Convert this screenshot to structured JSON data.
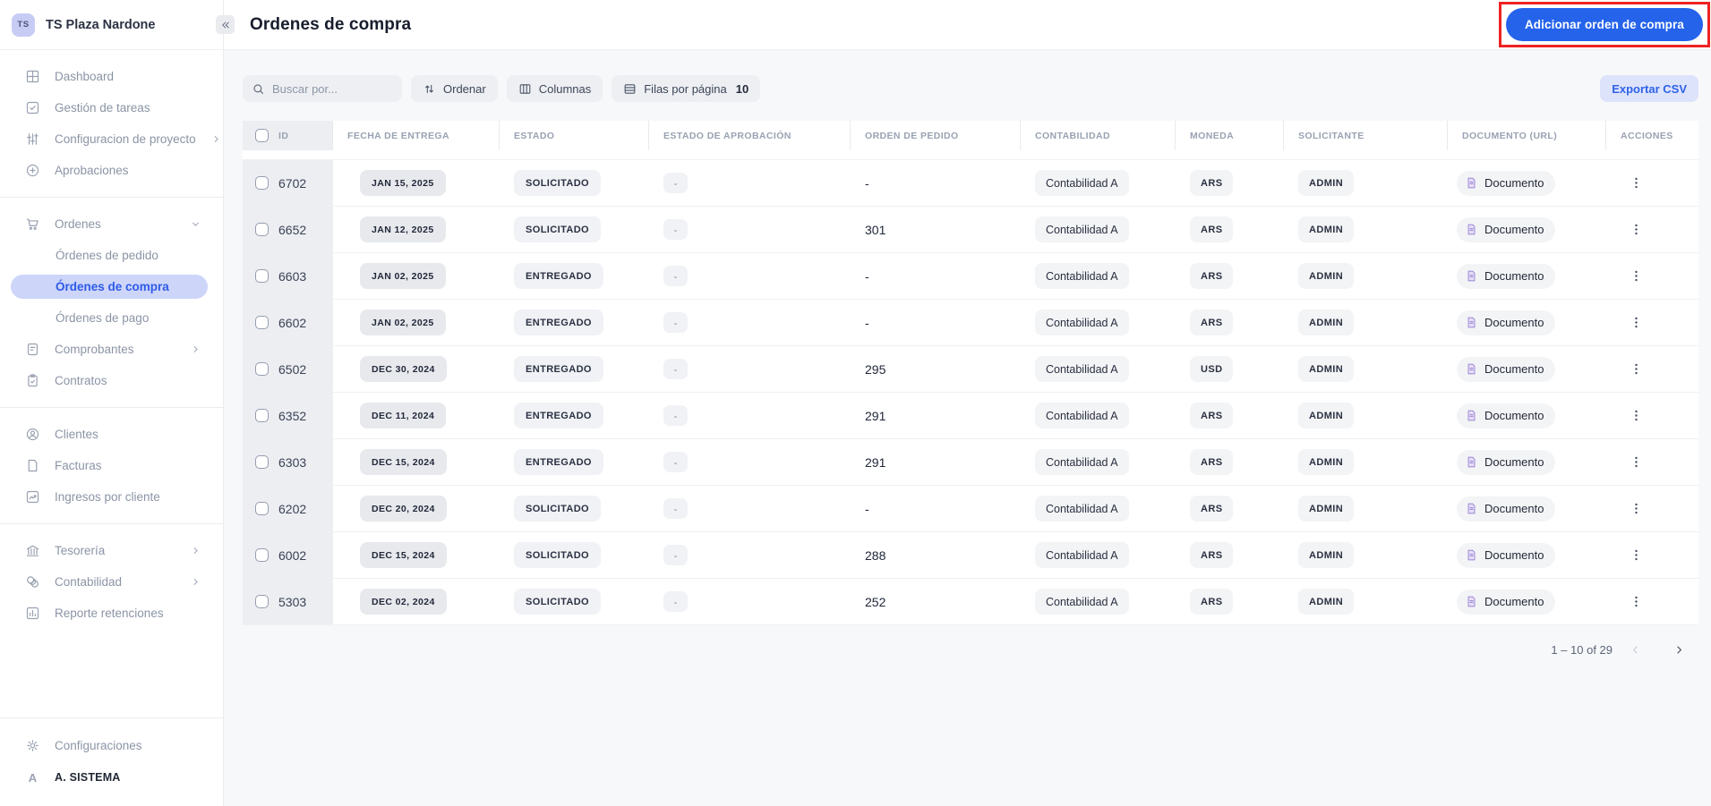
{
  "sidebar": {
    "workspace": {
      "initials": "TS",
      "name": "TS Plaza Nardone"
    },
    "groups": [
      {
        "items": [
          {
            "label": "Dashboard",
            "icon": "grid-icon"
          },
          {
            "label": "Gestión de tareas",
            "icon": "tasks-icon"
          },
          {
            "label": "Configuracion de proyecto",
            "icon": "sliders-icon",
            "chevron": "right"
          },
          {
            "label": "Aprobaciones",
            "icon": "plus-circle-icon"
          }
        ]
      },
      {
        "items": [
          {
            "label": "Ordenes",
            "icon": "cart-icon",
            "chevron": "down",
            "children": [
              {
                "label": "Órdenes de pedido"
              },
              {
                "label": "Órdenes de compra",
                "active": true
              },
              {
                "label": "Órdenes de pago"
              }
            ]
          },
          {
            "label": "Comprobantes",
            "icon": "clipboard-icon",
            "chevron": "right"
          },
          {
            "label": "Contratos",
            "icon": "contract-icon"
          }
        ]
      },
      {
        "items": [
          {
            "label": "Clientes",
            "icon": "user-circle-icon"
          },
          {
            "label": "Facturas",
            "icon": "file-icon"
          },
          {
            "label": "Ingresos por cliente",
            "icon": "chart-icon"
          }
        ]
      },
      {
        "items": [
          {
            "label": "Tesorería",
            "icon": "bank-icon",
            "chevron": "right"
          },
          {
            "label": "Contabilidad",
            "icon": "coins-icon",
            "chevron": "right"
          },
          {
            "label": "Reporte retenciones",
            "icon": "report-icon"
          }
        ]
      }
    ],
    "footer": {
      "settings_label": "Configuraciones",
      "settings_icon": "gear-icon",
      "user_initial": "A",
      "user_label": "A. SISTEMA"
    }
  },
  "header": {
    "title": "Ordenes de compra",
    "add_button_label": "Adicionar orden de compra"
  },
  "toolbar": {
    "search_placeholder": "Buscar por...",
    "sort_label": "Ordenar",
    "columns_label": "Columnas",
    "rows_per_page_label": "Filas por página",
    "rows_per_page_value": "10",
    "export_label": "Exportar CSV"
  },
  "table": {
    "columns": [
      "ID",
      "FECHA DE ENTREGA",
      "ESTADO",
      "ESTADO DE APROBACIÓN",
      "ORDEN DE PEDIDO",
      "CONTABILIDAD",
      "MONEDA",
      "SOLICITANTE",
      "DOCUMENTO (URL)",
      "ACCIONES"
    ],
    "document_label": "Documento",
    "rows": [
      {
        "id": "6702",
        "fecha": "JAN 15, 2025",
        "estado": "SOLICITADO",
        "aprobacion": "-",
        "pedido": "-",
        "contabilidad": "Contabilidad A",
        "moneda": "ARS",
        "solicitante": "ADMIN"
      },
      {
        "id": "6652",
        "fecha": "JAN 12, 2025",
        "estado": "SOLICITADO",
        "aprobacion": "-",
        "pedido": "301",
        "contabilidad": "Contabilidad A",
        "moneda": "ARS",
        "solicitante": "ADMIN"
      },
      {
        "id": "6603",
        "fecha": "JAN 02, 2025",
        "estado": "ENTREGADO",
        "aprobacion": "-",
        "pedido": "-",
        "contabilidad": "Contabilidad A",
        "moneda": "ARS",
        "solicitante": "ADMIN"
      },
      {
        "id": "6602",
        "fecha": "JAN 02, 2025",
        "estado": "ENTREGADO",
        "aprobacion": "-",
        "pedido": "-",
        "contabilidad": "Contabilidad A",
        "moneda": "ARS",
        "solicitante": "ADMIN"
      },
      {
        "id": "6502",
        "fecha": "DEC 30, 2024",
        "estado": "ENTREGADO",
        "aprobacion": "-",
        "pedido": "295",
        "contabilidad": "Contabilidad A",
        "moneda": "USD",
        "solicitante": "ADMIN"
      },
      {
        "id": "6352",
        "fecha": "DEC 11, 2024",
        "estado": "ENTREGADO",
        "aprobacion": "-",
        "pedido": "291",
        "contabilidad": "Contabilidad A",
        "moneda": "ARS",
        "solicitante": "ADMIN"
      },
      {
        "id": "6303",
        "fecha": "DEC 15, 2024",
        "estado": "ENTREGADO",
        "aprobacion": "-",
        "pedido": "291",
        "contabilidad": "Contabilidad A",
        "moneda": "ARS",
        "solicitante": "ADMIN"
      },
      {
        "id": "6202",
        "fecha": "DEC 20, 2024",
        "estado": "SOLICITADO",
        "aprobacion": "-",
        "pedido": "-",
        "contabilidad": "Contabilidad A",
        "moneda": "ARS",
        "solicitante": "ADMIN"
      },
      {
        "id": "6002",
        "fecha": "DEC 15, 2024",
        "estado": "SOLICITADO",
        "aprobacion": "-",
        "pedido": "288",
        "contabilidad": "Contabilidad A",
        "moneda": "ARS",
        "solicitante": "ADMIN"
      },
      {
        "id": "5303",
        "fecha": "DEC 02, 2024",
        "estado": "SOLICITADO",
        "aprobacion": "-",
        "pedido": "252",
        "contabilidad": "Contabilidad A",
        "moneda": "ARS",
        "solicitante": "ADMIN"
      }
    ]
  },
  "pagination": {
    "range_label": "1 – 10 of 29"
  },
  "colors": {
    "primary_blue": "#2563eb",
    "annotation_red": "#ee2222",
    "sidebar_active_bg": "#cdd5f9",
    "sidebar_active_text": "#2e5be8",
    "export_bg": "#dde3fb",
    "export_text": "#2f62e8",
    "document_icon_purple": "#a38fd8"
  }
}
